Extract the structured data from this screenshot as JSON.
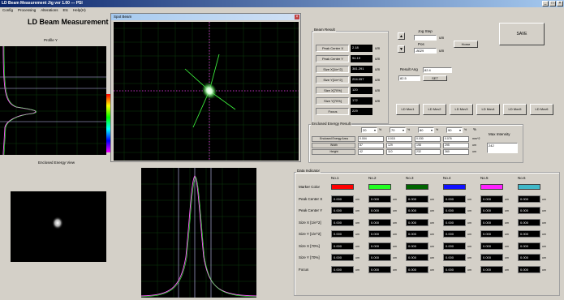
{
  "window": {
    "title": "LD Beam Measurement Jig ver 1.00 --- PSI"
  },
  "menu": [
    "Config",
    "Processing",
    "Alterations",
    "Etc",
    "Help(H)"
  ],
  "app_title": "LD Beam Measurement Jig",
  "profile_y_label": "Profile Y",
  "enclosed_energy_view_label": "Enclosed Energy View",
  "spot_window_title": "Spot Beam",
  "beam_result": {
    "title": "Beam Result",
    "rows": [
      {
        "label": "Peak Center X",
        "value": "2.18",
        "unit": "um"
      },
      {
        "label": "Peak Center Y",
        "value": "94.19",
        "unit": "um"
      },
      {
        "label": "Size X[1/e^2]",
        "value": "381.291",
        "unit": "um"
      },
      {
        "label": "Size Y[1/e^2]",
        "value": "204.057",
        "unit": "um"
      },
      {
        "label": "Size X[70%]",
        "value": "120",
        "unit": "um"
      },
      {
        "label": "Size Y[70%]",
        "value": "172",
        "unit": "um"
      },
      {
        "label": "Focus",
        "value": "229",
        "unit": ""
      }
    ]
  },
  "jog": {
    "step_label": "Jog Step",
    "step_value": "",
    "step_unit": "um",
    "pos_label": "Pos",
    "pos_value": "-8029",
    "pos_unit": "um",
    "home_label": "Home"
  },
  "save_label": "SAVE",
  "result_ang": {
    "label": "Result Ang",
    "value1": "82.4",
    "value2": "82.5",
    "button": "SET"
  },
  "ld_buttons": [
    "LD Mov1",
    "LD Mov2",
    "LD Mov3",
    "LD Mov4",
    "LD Mov5",
    "LD Mov6"
  ],
  "enclosed_energy": {
    "title": "Enclosed Energy Result",
    "selects": [
      "20",
      "70",
      "80",
      "90"
    ],
    "pct": "%",
    "max_intensity_label": "Max Intensity",
    "max_intensity_value": "242",
    "rows": [
      {
        "label": "Enclosed Energy Area",
        "values": [
          "0.004",
          "0.015",
          "0.030",
          "0.076"
        ],
        "unit": "mm^2"
      },
      {
        "label": "Width",
        "values": [
          "87",
          "129",
          "198",
          "295"
        ],
        "unit": "um"
      },
      {
        "label": "Height",
        "values": [
          "42",
          "110",
          "232",
          "360"
        ],
        "unit": "um"
      }
    ]
  },
  "data_indicator": {
    "title": "Data Indicator",
    "columns": [
      "No.1",
      "No.2",
      "No.3",
      "No.4",
      "No.5",
      "No.6"
    ],
    "marker_colors": [
      "#ff0000",
      "#22ff22",
      "#006400",
      "#1010ff",
      "#ff22ff",
      "#40b8c8"
    ],
    "row_labels": [
      "Marker Color",
      "Peak Center X",
      "Peak Center Y",
      "Size X [1/e^2]",
      "Size Y [1/e^2]",
      "Size X [70%]",
      "Size Y [70%]",
      "Focus"
    ],
    "cell_value": "0.000",
    "unit": "um"
  },
  "colors": {
    "titlebar": "#0a246a",
    "plot_bg": "#000000",
    "grid": "#0c3a0c"
  }
}
